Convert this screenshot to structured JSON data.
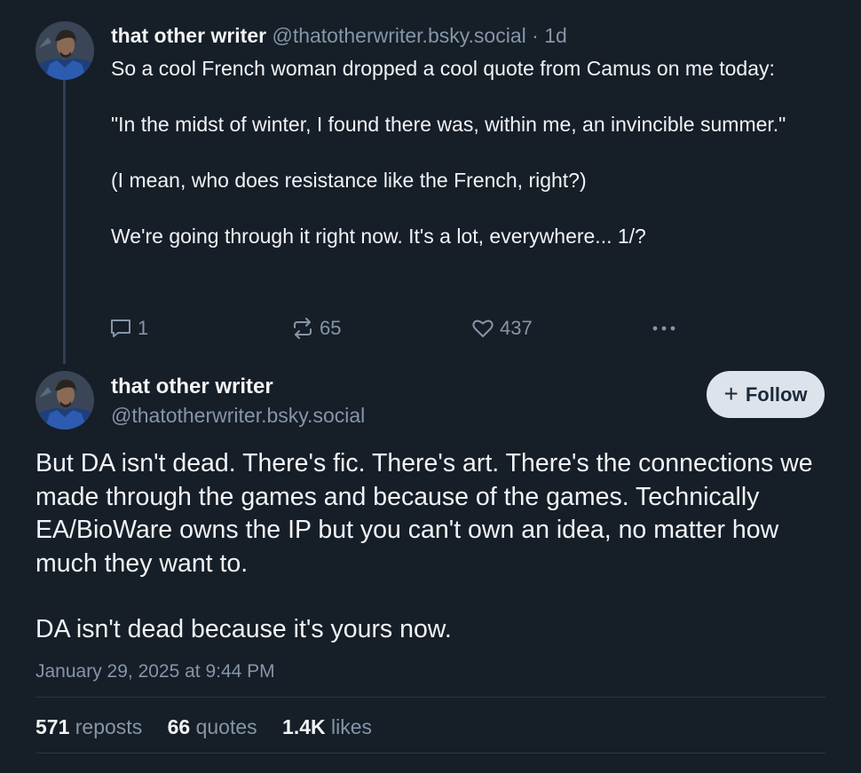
{
  "parent_post": {
    "author": "that other writer",
    "handle": "@thatotherwriter.bsky.social",
    "separator": "·",
    "age": "1d",
    "paragraphs": [
      "So a cool French woman dropped a cool quote from Camus on me today:",
      "\"In the midst of winter, I found there was, within me, an invincible summer.\"",
      "(I mean, who does resistance like the French, right?)",
      "We're going through it right now. It's a lot, everywhere... 1/?"
    ],
    "actions": {
      "reply_count": "1",
      "repost_count": "65",
      "like_count": "437",
      "more_icon": "ellipsis-icon"
    }
  },
  "main_post": {
    "author": "that other writer",
    "handle": "@thatotherwriter.bsky.social",
    "follow_plus": "+",
    "follow_label": "Follow",
    "paragraphs": [
      "But DA isn't dead. There's fic. There's art. There's the connections we made through the games and because of the games. Technically EA/BioWare owns the IP but you can't own an idea, no matter how much they want to.",
      "DA isn't dead because it's  yours now."
    ],
    "timestamp": "January 29, 2025 at 9:44 PM",
    "stats": {
      "reposts_count": "571",
      "reposts_label": "reposts",
      "quotes_count": "66",
      "quotes_label": "quotes",
      "likes_count": "1.4K",
      "likes_label": "likes"
    }
  },
  "colors": {
    "background": "#161e27",
    "text_primary": "#f1f3f5",
    "text_secondary": "#8596a8",
    "follow_button_bg": "#dde3ea",
    "thread_line": "#2e4052"
  },
  "icons": {
    "reply": "speech-bubble-icon",
    "repost": "repost-arrows-icon",
    "like": "heart-icon",
    "more": "ellipsis-icon"
  }
}
